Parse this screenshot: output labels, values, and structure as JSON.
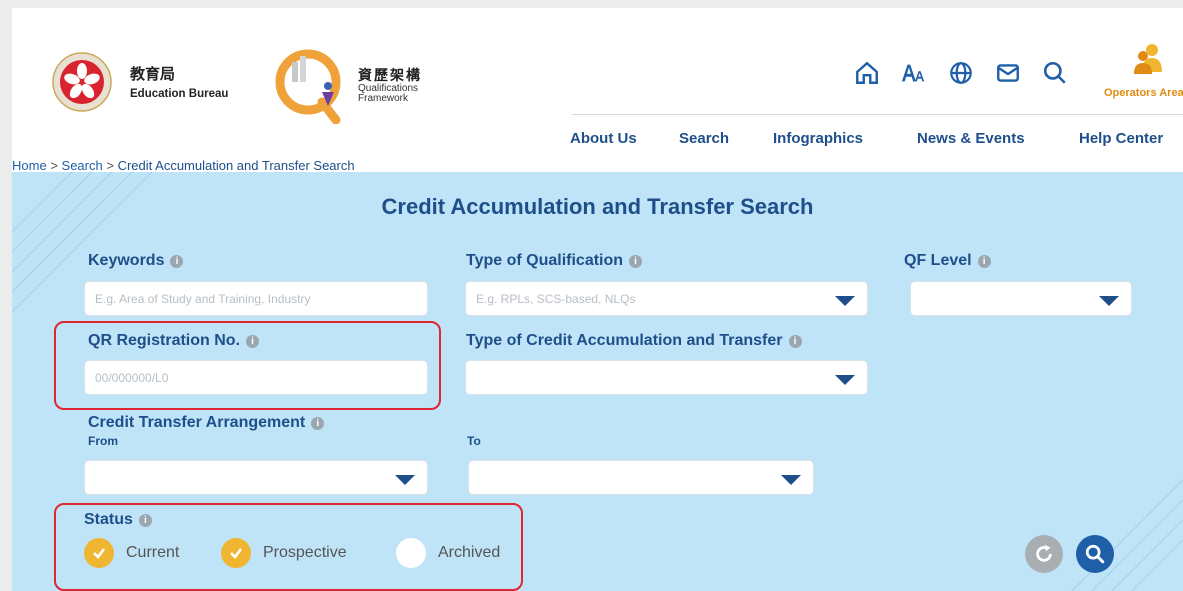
{
  "header": {
    "edb_logo_zh": "教育局",
    "edb_logo_en": "Education Bureau",
    "qf_logo_zh": "資歷架構",
    "qf_logo_en": "Qualifications Framework",
    "operators_area": "Operators Area",
    "icons": [
      "home-icon",
      "font-size-icon",
      "language-globe-icon",
      "mail-icon",
      "search-icon",
      "operators-icon"
    ]
  },
  "nav": {
    "items": [
      "About Us",
      "Search",
      "Infographics",
      "News & Events",
      "Help Center"
    ]
  },
  "breadcrumb": {
    "home": "Home",
    "search": "Search",
    "current": "Credit Accumulation and Transfer Search",
    "separator": ">"
  },
  "panel": {
    "title": "Credit Accumulation and Transfer Search",
    "keywords": {
      "label": "Keywords",
      "placeholder": "E.g. Area of Study and Training, Industry"
    },
    "type_of_qualification": {
      "label": "Type of Qualification",
      "placeholder": "E.g. RPLs, SCS-based, NLQs"
    },
    "qf_level": {
      "label": "QF Level"
    },
    "qr_registration": {
      "label": "QR Registration No.",
      "placeholder": "00/000000/L0"
    },
    "type_of_cat": {
      "label": "Type of Credit Accumulation and Transfer"
    },
    "credit_transfer": {
      "label": "Credit Transfer Arrangement",
      "from": "From",
      "to": "To"
    },
    "status": {
      "label": "Status",
      "options": [
        {
          "label": "Current",
          "checked": true
        },
        {
          "label": "Prospective",
          "checked": true
        },
        {
          "label": "Archived",
          "checked": false
        }
      ]
    }
  },
  "colors": {
    "brand_blue": "#1f4f8a",
    "panel_bg": "#bfe4f7",
    "check_yellow": "#f0b632",
    "highlight_red": "#e0262f",
    "operators_orange": "#e08a13"
  }
}
